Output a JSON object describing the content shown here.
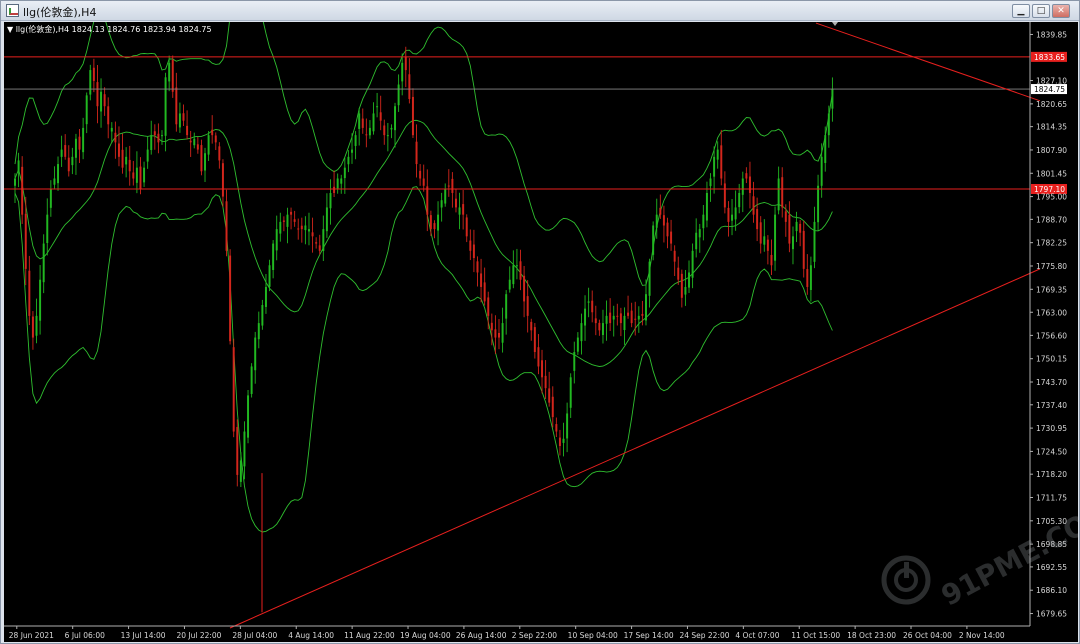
{
  "window": {
    "title": "llg(伦敦金),H4",
    "buttons": {
      "minimize": "▁",
      "maximize": "□",
      "close": "✕"
    }
  },
  "chart_data": {
    "type": "candlestick",
    "header": "▼ llg(伦敦金),H4  1824.13 1824.76 1823.94 1824.75",
    "symbol": "llg(伦敦金)",
    "timeframe": "H4",
    "ohlc": {
      "open": 1824.13,
      "high": 1824.76,
      "low": 1823.94,
      "close": 1824.75
    },
    "ylim": [
      1676.2,
      1843.3
    ],
    "yticks": [
      1839.85,
      1827.1,
      1820.65,
      1814.35,
      1807.9,
      1801.45,
      1795.0,
      1788.7,
      1782.25,
      1775.8,
      1769.35,
      1763.0,
      1756.6,
      1750.15,
      1743.7,
      1737.4,
      1730.95,
      1724.5,
      1718.2,
      1711.75,
      1705.3,
      1698.85,
      1692.55,
      1686.1,
      1679.65
    ],
    "xticks": [
      "28 Jun 2021",
      "6 Jul 06:00",
      "13 Jul 14:00",
      "20 Jul 22:00",
      "28 Jul 04:00",
      "4 Aug 14:00",
      "11 Aug 22:00",
      "19 Aug 04:00",
      "26 Aug 14:00",
      "2 Sep 22:00",
      "10 Sep 04:00",
      "17 Sep 14:00",
      "24 Sep 22:00",
      "4 Oct 07:00",
      "11 Oct 15:00",
      "18 Oct 23:00",
      "26 Oct 04:00",
      "2 Nov 14:00"
    ],
    "horizontal_lines": [
      {
        "value": 1833.65,
        "label": "1833.65",
        "color": "#e8201e"
      },
      {
        "value": 1797.1,
        "label": "1797.10",
        "color": "#e8201e"
      },
      {
        "value": 1824.75,
        "label": "1824.75",
        "color": "#888888",
        "type": "bid"
      }
    ],
    "trend_lines": [
      {
        "from": [
          "4 Aug 14:00",
          1680.0
        ],
        "to": [
          "right edge",
          1775.0
        ],
        "color": "#e8201e"
      },
      {
        "from": [
          "2 Nov 14:00",
          1843.0
        ],
        "to": [
          "right edge",
          1821.5
        ],
        "color": "#e8201e"
      }
    ],
    "vertical_line": {
      "at": "4 Aug 14:00",
      "from": 1680.0,
      "to": 1718.5,
      "color": "#e8201e"
    },
    "bollinger": {
      "color": "#2fbf2f"
    },
    "closes": [
      1800,
      1805,
      1790,
      1775,
      1762,
      1756,
      1762,
      1772,
      1782,
      1790,
      1797,
      1800,
      1804,
      1808,
      1806,
      1802,
      1806,
      1811,
      1808,
      1814,
      1823,
      1830,
      1827,
      1820,
      1824,
      1820,
      1815,
      1814,
      1810,
      1806,
      1803,
      1806,
      1802,
      1800,
      1803,
      1797,
      1803,
      1808,
      1812,
      1812,
      1810,
      1812,
      1828,
      1832,
      1824,
      1815,
      1818,
      1816,
      1812,
      1810,
      1811,
      1808,
      1802,
      1807,
      1812,
      1812,
      1810,
      1805,
      1795,
      1780,
      1755,
      1730,
      1718,
      1722,
      1730,
      1740,
      1748,
      1756,
      1760,
      1765,
      1770,
      1776,
      1782,
      1786,
      1788,
      1788,
      1790,
      1790,
      1788,
      1786,
      1786,
      1787,
      1786,
      1784,
      1782,
      1780,
      1786,
      1792,
      1796,
      1796,
      1800,
      1800,
      1803,
      1806,
      1808,
      1812,
      1818,
      1814,
      1812,
      1814,
      1818,
      1820,
      1816,
      1812,
      1812,
      1814,
      1820,
      1826,
      1832,
      1830,
      1822,
      1812,
      1804,
      1800,
      1798,
      1790,
      1786,
      1786,
      1790,
      1794,
      1797,
      1798,
      1796,
      1792,
      1792,
      1790,
      1784,
      1780,
      1778,
      1774,
      1770,
      1766,
      1762,
      1758,
      1756,
      1756,
      1760,
      1768,
      1772,
      1776,
      1776,
      1772,
      1766,
      1762,
      1758,
      1752,
      1748,
      1745,
      1742,
      1738,
      1734,
      1730,
      1726,
      1728,
      1735,
      1745,
      1752,
      1756,
      1760,
      1764,
      1766,
      1763,
      1760,
      1758,
      1760,
      1762,
      1760,
      1762,
      1762,
      1760,
      1762,
      1762,
      1760,
      1761,
      1762,
      1762,
      1768,
      1777,
      1787,
      1790,
      1790,
      1787,
      1784,
      1782,
      1777,
      1772,
      1767,
      1770,
      1774,
      1780,
      1785,
      1786,
      1790,
      1796,
      1800,
      1806,
      1808,
      1800,
      1792,
      1788,
      1790,
      1792,
      1796,
      1800,
      1800,
      1796,
      1790,
      1786,
      1782,
      1784,
      1780,
      1776,
      1790,
      1800,
      1792,
      1788,
      1782,
      1784,
      1788,
      1785,
      1775,
      1770,
      1776,
      1788,
      1798,
      1806,
      1812,
      1818,
      1824.75
    ]
  }
}
